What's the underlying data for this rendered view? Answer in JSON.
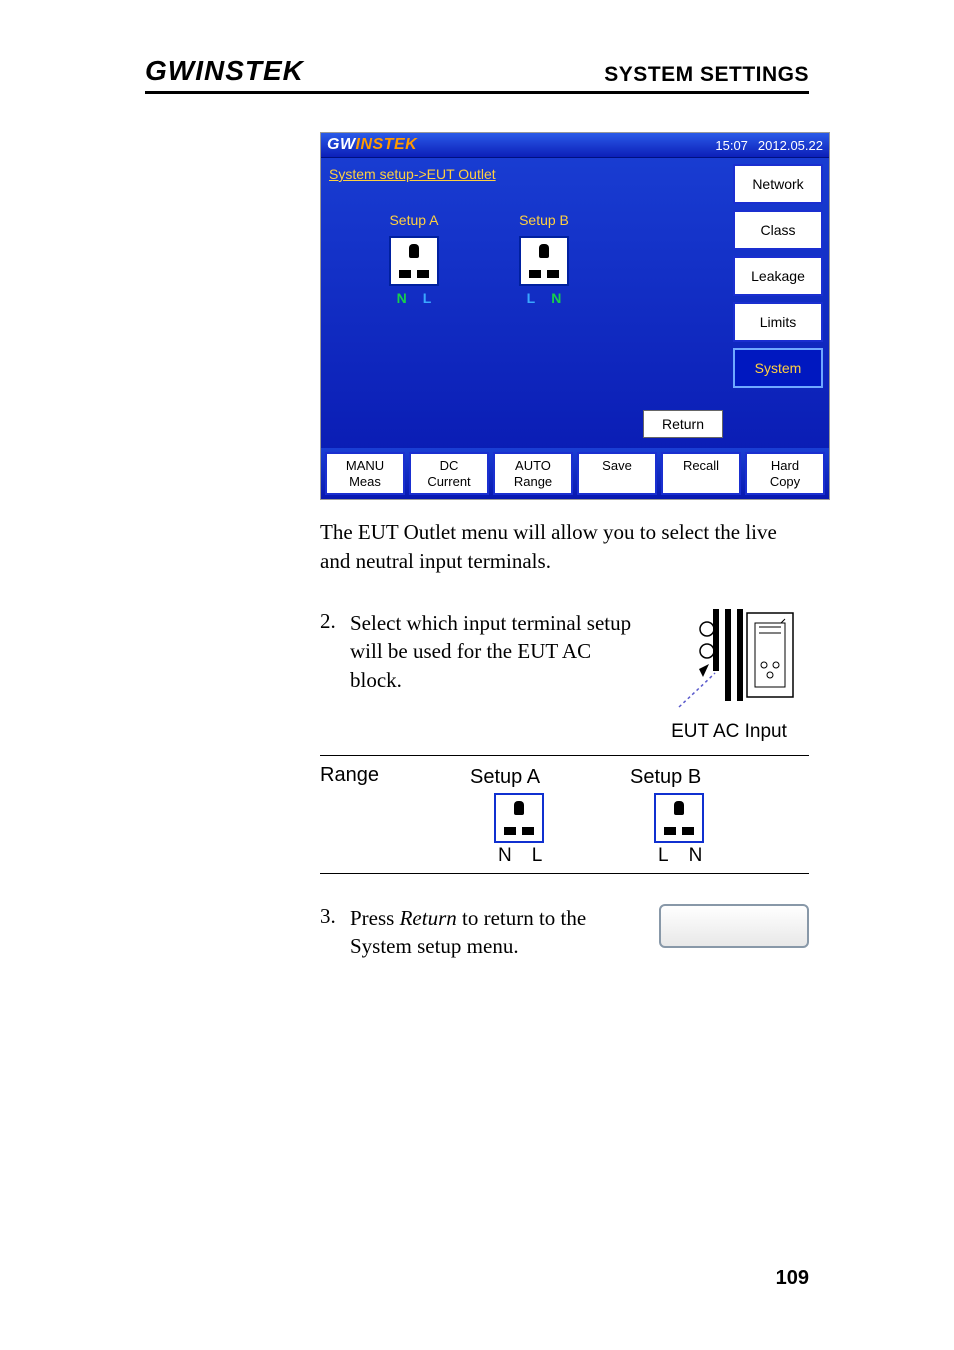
{
  "header": {
    "logo_text": "GWINSTEK",
    "section": "SYSTEM SETTINGS"
  },
  "device": {
    "logo_a": "GW",
    "logo_b": "INSTEK",
    "time": "15:07",
    "date": "2012.05.22",
    "breadcrumb": "System setup->EUT Outlet",
    "setupA": {
      "label": "Setup A",
      "left": "N",
      "right": "L"
    },
    "setupB": {
      "label": "Setup B",
      "left": "L",
      "right": "N"
    },
    "return": "Return",
    "side": [
      "Network",
      "Class",
      "Leakage",
      "Limits",
      "System"
    ],
    "bottom": [
      {
        "l1": "MANU",
        "l2": "Meas"
      },
      {
        "l1": "DC",
        "l2": "Current"
      },
      {
        "l1": "AUTO",
        "l2": "Range"
      },
      {
        "l1": "Save",
        "l2": ""
      },
      {
        "l1": "Recall",
        "l2": ""
      },
      {
        "l1": "Hard",
        "l2": "Copy"
      }
    ]
  },
  "para1": "The EUT Outlet menu will allow you to select the live and neutral input terminals.",
  "step2": {
    "num": "2.",
    "text": "Select which input terminal setup will be used for the EUT AC block.",
    "caption": "EUT AC Input"
  },
  "range": {
    "label": "Range",
    "colA": "Setup A",
    "colB": "Setup B",
    "a_left": "N",
    "a_right": "L",
    "b_left": "L",
    "b_right": "N"
  },
  "step3": {
    "num": "3.",
    "text_a": "Press ",
    "text_em": "Return",
    "text_b": " to return to the System setup menu."
  },
  "page_num": "109"
}
